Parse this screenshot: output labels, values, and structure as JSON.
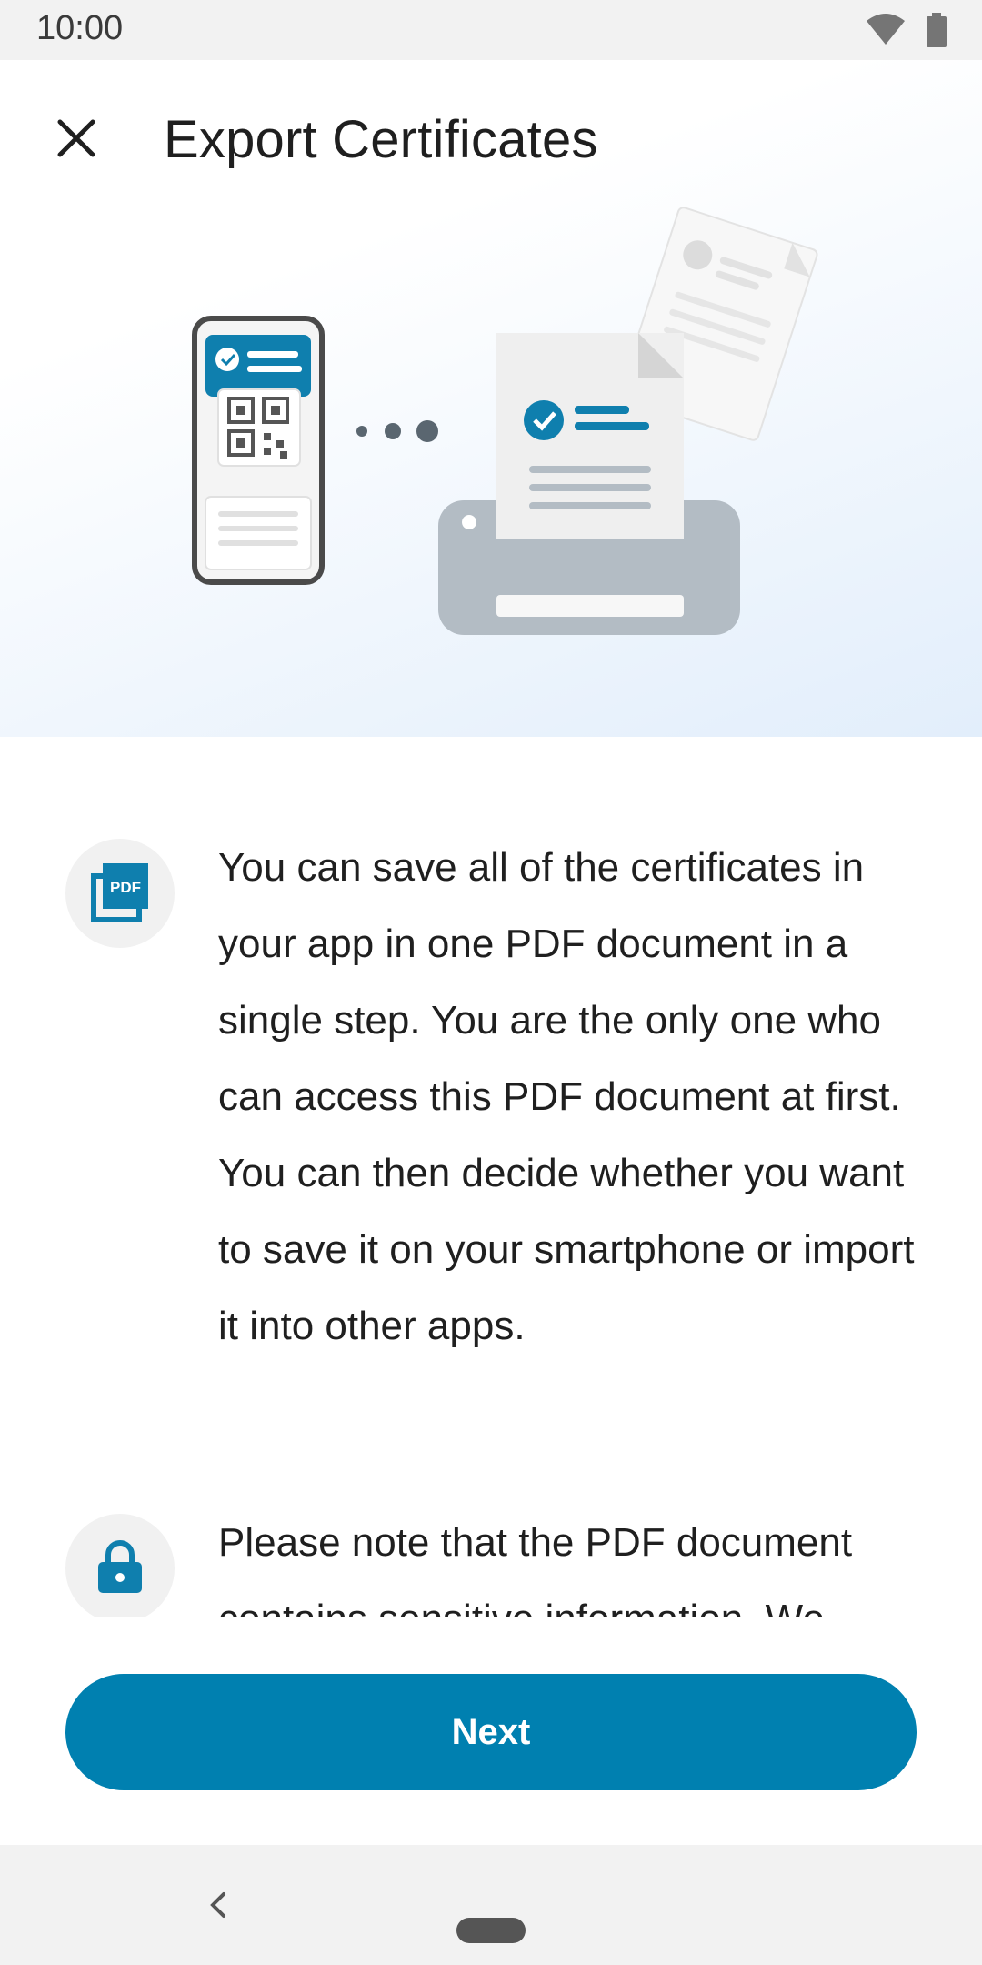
{
  "status_bar": {
    "time": "10:00",
    "icons": [
      "wifi-icon",
      "battery-icon"
    ]
  },
  "header": {
    "title": "Export Certificates",
    "close_icon": "close-icon"
  },
  "illustration": {
    "icons": [
      "phone-certificate-icon",
      "qr-code-icon",
      "printer-icon",
      "document-icon"
    ]
  },
  "content": {
    "items": [
      {
        "icon": "pdf-icon",
        "icon_text": "PDF",
        "text": "You can save all of the certificates in your app in one PDF document in a single step. You are the only one who can access this PDF document at first. You can then decide whether you want to save it on your smartphone or import it into other apps."
      },
      {
        "icon": "lock-icon",
        "text": "Please note that the PDF document contains sensitive information. We"
      }
    ]
  },
  "footer": {
    "next_label": "Next"
  },
  "colors": {
    "accent": "#0080b0",
    "icon_bg": "#f1f1f1",
    "hero_gradient_end": "#e2eefb"
  }
}
